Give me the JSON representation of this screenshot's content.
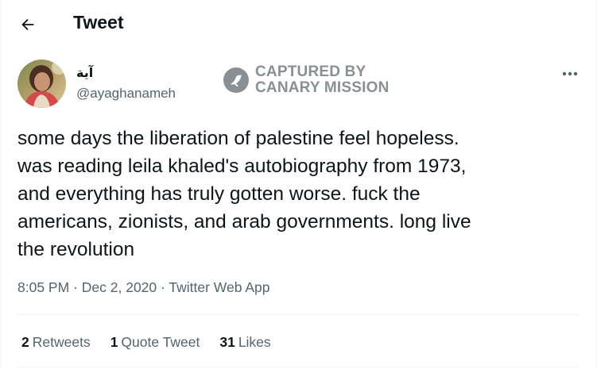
{
  "header": {
    "title": "Tweet",
    "back_icon": "back-arrow-icon"
  },
  "author": {
    "display_name": "آية",
    "handle": "@ayaghanameh"
  },
  "watermark": {
    "line1": "CAPTURED BY",
    "line2": "CANARY MISSION",
    "logo_icon": "canary-logo-icon",
    "color": "#8a8f94"
  },
  "more_icon": "more-dots-icon",
  "tweet": {
    "text": "some days the liberation of palestine feel hopeless.\nwas reading leila khaled's autobiography from 1973,\nand everything has truly gotten worse. fuck the\namericans, zionists, and arab governments. long live\nthe revolution",
    "time": "8:05 PM",
    "date": "Dec 2, 2020",
    "source": "Twitter Web App",
    "separator": "·"
  },
  "stats": {
    "retweets": {
      "count": "2",
      "label": "Retweets"
    },
    "quotes": {
      "count": "1",
      "label": "Quote Tweet"
    },
    "likes": {
      "count": "31",
      "label": "Likes"
    }
  },
  "colors": {
    "text_primary": "#0f1419",
    "text_secondary": "#536471",
    "divider": "#eff3f4"
  }
}
